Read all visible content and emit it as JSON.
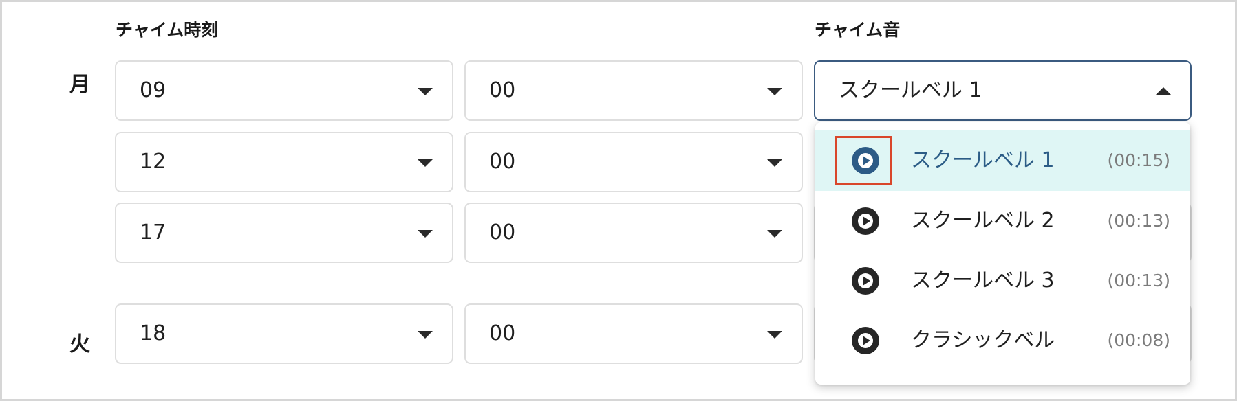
{
  "headers": {
    "time": "チャイム時刻",
    "sound": "チャイム音"
  },
  "days": [
    {
      "label": "月",
      "rows": [
        {
          "hour": "09",
          "minute": "00"
        },
        {
          "hour": "12",
          "minute": "00"
        },
        {
          "hour": "17",
          "minute": "00"
        }
      ]
    },
    {
      "label": "火",
      "rows": [
        {
          "hour": "18",
          "minute": "00"
        }
      ]
    }
  ],
  "sound_select": {
    "value": "スクールベル 1",
    "options": [
      {
        "name": "スクールベル 1",
        "duration": "(00:15)",
        "icon": "play-circle-icon",
        "selected": true
      },
      {
        "name": "スクールベル 2",
        "duration": "(00:13)",
        "icon": "play-circle-icon"
      },
      {
        "name": "スクールベル 3",
        "duration": "(00:13)",
        "icon": "play-circle-icon"
      },
      {
        "name": "クラシックベル",
        "duration": "(00:08)",
        "icon": "play-circle-icon"
      }
    ]
  },
  "colors": {
    "accent": "#2d5b86",
    "selected_bg": "#dff6f5",
    "highlight_box": "#d9472b"
  }
}
